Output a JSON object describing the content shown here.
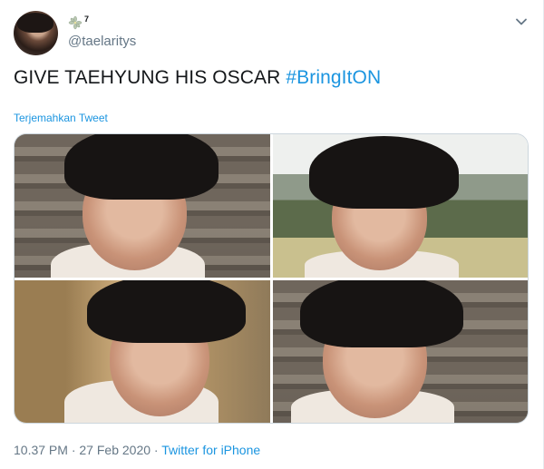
{
  "author": {
    "name_suffix": "7",
    "handle": "@taelaritys"
  },
  "tweet": {
    "text": "GIVE TAEHYUNG HIS OSCAR ",
    "hashtag": "#BringItON",
    "translate_label": "Terjemahkan Tweet"
  },
  "meta": {
    "time": "10.37 PM",
    "separator": " · ",
    "date": "27 Feb 2020",
    "source": "Twitter for iPhone"
  },
  "colors": {
    "link": "#1b95e0",
    "text": "#14171a",
    "muted": "#657786"
  },
  "icons": {
    "name_decoration": "flower-icon",
    "menu": "chevron-down-icon"
  }
}
